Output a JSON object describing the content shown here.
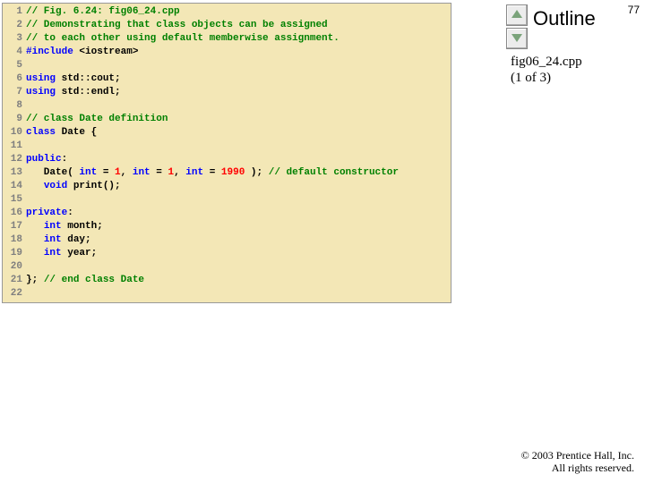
{
  "pageNumber": "77",
  "outlineTitle": "Outline",
  "caption": {
    "file": "fig06_24.cpp",
    "part": "(1 of 3)"
  },
  "footer": {
    "line1": "© 2003 Prentice Hall, Inc.",
    "line2": "All rights reserved."
  },
  "nav": {
    "up": "previous-slide",
    "down": "next-slide"
  },
  "code": [
    {
      "n": "1",
      "seg": [
        {
          "c": "c-comment",
          "t": "// Fig. 6.24: fig06_24.cpp"
        }
      ]
    },
    {
      "n": "2",
      "seg": [
        {
          "c": "c-comment",
          "t": "// Demonstrating that class objects can be assigned"
        }
      ]
    },
    {
      "n": "3",
      "seg": [
        {
          "c": "c-comment",
          "t": "// to each other using default memberwise assignment."
        }
      ]
    },
    {
      "n": "4",
      "seg": [
        {
          "c": "c-keyword",
          "t": "#include "
        },
        {
          "c": "c-plain",
          "t": "<iostream>"
        }
      ]
    },
    {
      "n": "5",
      "seg": []
    },
    {
      "n": "6",
      "seg": [
        {
          "c": "c-keyword",
          "t": "using "
        },
        {
          "c": "c-plain",
          "t": "std::cout;"
        }
      ]
    },
    {
      "n": "7",
      "seg": [
        {
          "c": "c-keyword",
          "t": "using "
        },
        {
          "c": "c-plain",
          "t": "std::endl;"
        }
      ]
    },
    {
      "n": "8",
      "seg": []
    },
    {
      "n": "9",
      "seg": [
        {
          "c": "c-comment",
          "t": "// class Date definition"
        }
      ]
    },
    {
      "n": "10",
      "seg": [
        {
          "c": "c-keyword",
          "t": "class "
        },
        {
          "c": "c-plain",
          "t": "Date {"
        }
      ]
    },
    {
      "n": "11",
      "seg": []
    },
    {
      "n": "12",
      "seg": [
        {
          "c": "c-keyword",
          "t": "public"
        },
        {
          "c": "c-plain",
          "t": ":"
        }
      ]
    },
    {
      "n": "13",
      "seg": [
        {
          "c": "c-plain",
          "t": "   Date( "
        },
        {
          "c": "c-keyword",
          "t": "int"
        },
        {
          "c": "c-plain",
          "t": " = "
        },
        {
          "c": "c-number",
          "t": "1"
        },
        {
          "c": "c-plain",
          "t": ", "
        },
        {
          "c": "c-keyword",
          "t": "int"
        },
        {
          "c": "c-plain",
          "t": " = "
        },
        {
          "c": "c-number",
          "t": "1"
        },
        {
          "c": "c-plain",
          "t": ", "
        },
        {
          "c": "c-keyword",
          "t": "int"
        },
        {
          "c": "c-plain",
          "t": " = "
        },
        {
          "c": "c-number",
          "t": "1990"
        },
        {
          "c": "c-plain",
          "t": " ); "
        },
        {
          "c": "c-comment",
          "t": "// default constructor"
        }
      ]
    },
    {
      "n": "14",
      "seg": [
        {
          "c": "c-plain",
          "t": "   "
        },
        {
          "c": "c-keyword",
          "t": "void"
        },
        {
          "c": "c-plain",
          "t": " print();"
        }
      ]
    },
    {
      "n": "15",
      "seg": []
    },
    {
      "n": "16",
      "seg": [
        {
          "c": "c-keyword",
          "t": "private"
        },
        {
          "c": "c-plain",
          "t": ":"
        }
      ]
    },
    {
      "n": "17",
      "seg": [
        {
          "c": "c-plain",
          "t": "   "
        },
        {
          "c": "c-keyword",
          "t": "int"
        },
        {
          "c": "c-plain",
          "t": " month;"
        }
      ]
    },
    {
      "n": "18",
      "seg": [
        {
          "c": "c-plain",
          "t": "   "
        },
        {
          "c": "c-keyword",
          "t": "int"
        },
        {
          "c": "c-plain",
          "t": " day;"
        }
      ]
    },
    {
      "n": "19",
      "seg": [
        {
          "c": "c-plain",
          "t": "   "
        },
        {
          "c": "c-keyword",
          "t": "int"
        },
        {
          "c": "c-plain",
          "t": " year;"
        }
      ]
    },
    {
      "n": "20",
      "seg": []
    },
    {
      "n": "21",
      "seg": [
        {
          "c": "c-plain",
          "t": "}; "
        },
        {
          "c": "c-comment",
          "t": "// end class Date"
        }
      ]
    },
    {
      "n": "22",
      "seg": []
    }
  ]
}
